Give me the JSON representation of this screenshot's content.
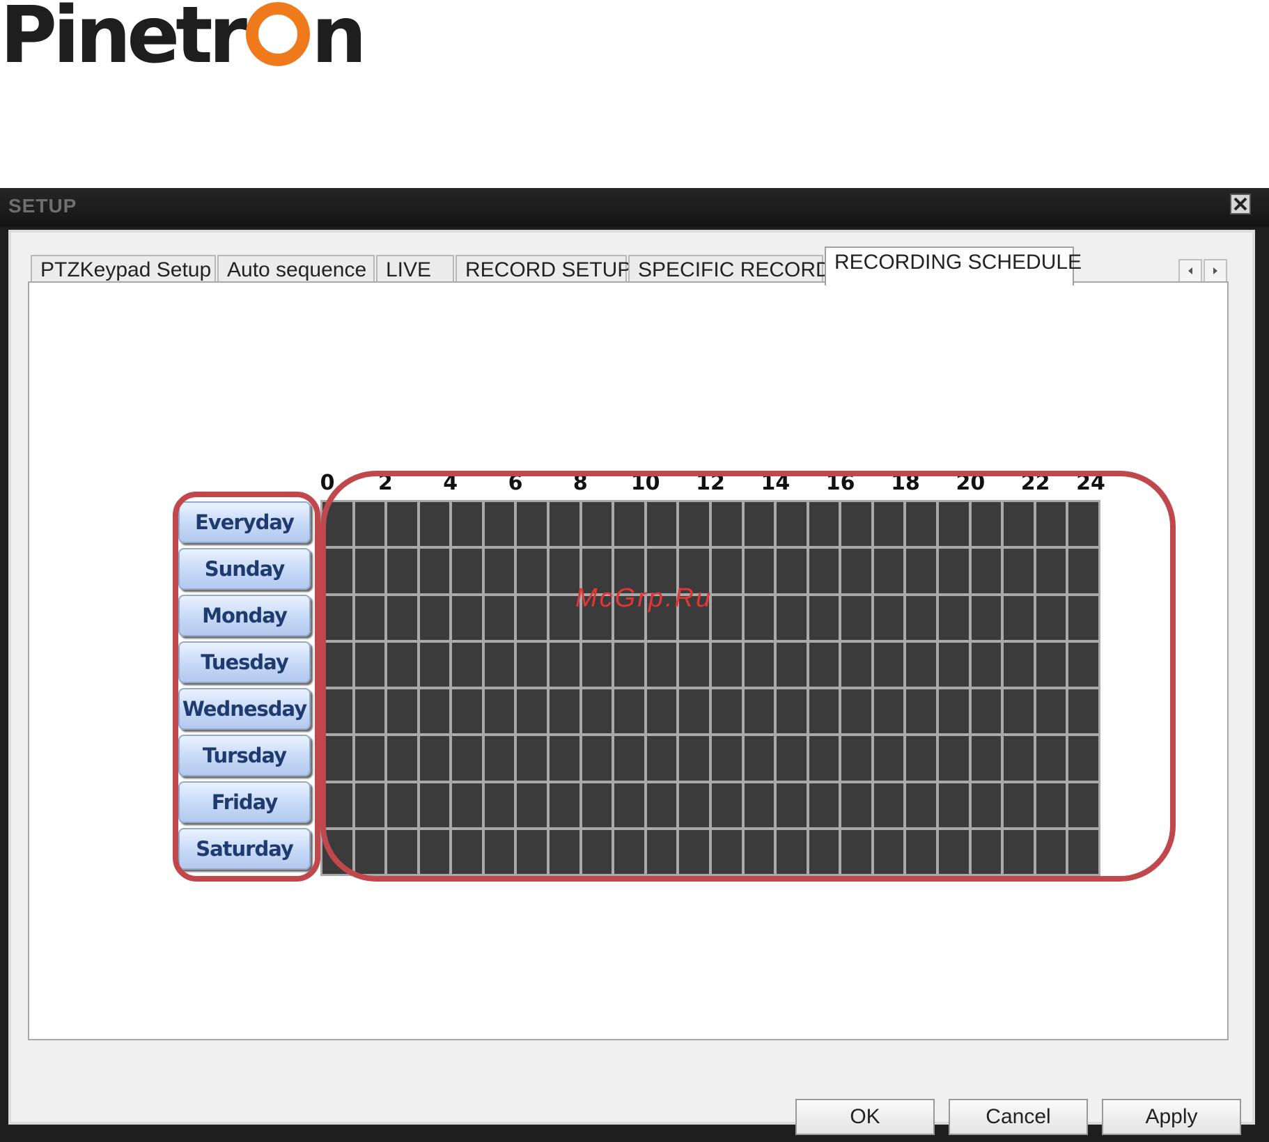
{
  "logo": {
    "text": "Pinetron",
    "pre": "Pinetr",
    "post": "n",
    "accent_color": "#ee7a1c"
  },
  "window": {
    "title": "SETUP",
    "close_icon": "close-icon"
  },
  "tabs": [
    {
      "label": "PTZKeypad Setup"
    },
    {
      "label": "Auto sequence"
    },
    {
      "label": "LIVE"
    },
    {
      "label": "RECORD SETUP"
    },
    {
      "label": "SPECIFIC RECORD"
    },
    {
      "label": "RECORDING SCHEDULE",
      "active": true
    }
  ],
  "tab_scroll": {
    "left_icon": "arrow-left-icon",
    "right_icon": "arrow-right-icon"
  },
  "schedule": {
    "hour_labels": [
      "0",
      "2",
      "4",
      "6",
      "8",
      "10",
      "12",
      "14",
      "16",
      "18",
      "20",
      "22",
      "24"
    ],
    "days": [
      "Everyday",
      "Sunday",
      "Monday",
      "Tuesday",
      "Wednesday",
      "Tursday",
      "Friday",
      "Saturday"
    ],
    "hours_per_day": 24,
    "cell_color": "#3b3b3b",
    "highlight_color": "#c0474c"
  },
  "watermark": "McGrp.Ru",
  "buttons": {
    "ok": "OK",
    "cancel": "Cancel",
    "apply": "Apply"
  }
}
